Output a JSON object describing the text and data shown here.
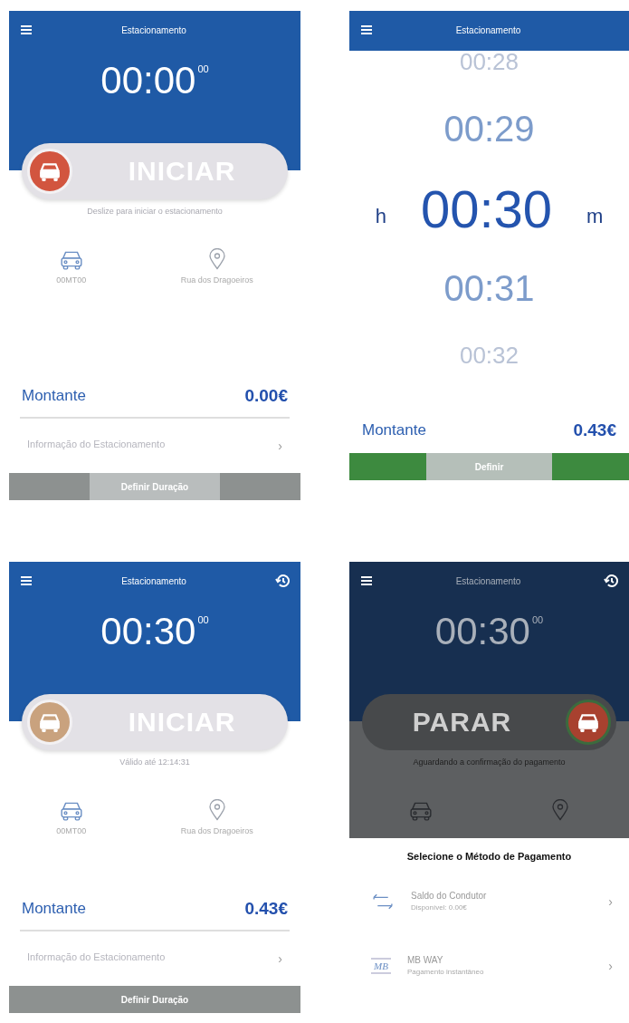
{
  "screens": [
    {
      "kind": "timer",
      "header": {
        "title": "Estacionamento",
        "history_icon": false
      },
      "timer": {
        "time": "00:00",
        "seconds": "00"
      },
      "slider": {
        "label": "INICIAR",
        "kind": "start",
        "color": "#d2553f"
      },
      "hint": "Deslize para iniciar o estacionamento",
      "info": [
        {
          "kind": "car",
          "label": "00MT00"
        },
        {
          "kind": "location",
          "label": "Rua dos Dragoeiros"
        }
      ],
      "amount": {
        "label": "Montante",
        "value": "0.00€"
      },
      "details_link": {
        "label": "Informação do Estacionamento",
        "chevron": "›"
      },
      "action_button": {
        "label": "Definir Duração",
        "kind": "split"
      }
    },
    {
      "kind": "picker",
      "header": {
        "title": "Estacionamento",
        "history_icon": false
      },
      "unit_left": "h",
      "unit_right": "m",
      "rows": [
        {
          "text": "00:28",
          "selected": false,
          "faded": true
        },
        {
          "text": "00:29",
          "selected": false,
          "faded": false
        },
        {
          "text": "00:30",
          "selected": true,
          "faded": false
        },
        {
          "text": "00:31",
          "selected": false,
          "faded": false
        },
        {
          "text": "00:32",
          "selected": false,
          "faded": true
        }
      ],
      "amount": {
        "label": "Montante",
        "value": "0.43€"
      },
      "action_button": {
        "label": "Definir",
        "kind": "accent"
      }
    },
    {
      "kind": "timer",
      "header": {
        "title": "Estacionamento",
        "history_icon": true
      },
      "timer": {
        "time": "00:30",
        "seconds": "00"
      },
      "slider": {
        "label": "INICIAR",
        "kind": "start",
        "color": "#c9a27e"
      },
      "hint": "Válido até 12:14:31",
      "info": [
        {
          "kind": "car",
          "label": "00MT00"
        },
        {
          "kind": "location",
          "label": "Rua dos Dragoeiros"
        }
      ],
      "amount": {
        "label": "Montante",
        "value": "0.43€"
      },
      "details_link": {
        "label": "Informação do Estacionamento",
        "chevron": "›"
      },
      "action_button": {
        "label": "Definir Duração",
        "kind": "solid"
      }
    },
    {
      "kind": "timer",
      "dimmed": true,
      "header": {
        "title": "Estacionamento",
        "history_icon": true
      },
      "timer": {
        "time": "00:30",
        "seconds": "00"
      },
      "slider": {
        "label": "PARAR",
        "kind": "end",
        "color": "#a8412f"
      },
      "hint": "Aguardando a confirmação do pagamento",
      "info": [
        {
          "kind": "car"
        },
        {
          "kind": "location"
        }
      ],
      "payment_sheet": {
        "title": "Selecione o Método de Pagamento",
        "methods": [
          {
            "kind": "balance",
            "name": "Saldo do Condutor",
            "detail": "Disponível: 0.00€",
            "chevron": "›"
          },
          {
            "kind": "mbway",
            "logo_text": "MB",
            "name": "MB WAY",
            "detail": "Pagamento instantâneo",
            "chevron": "›"
          }
        ]
      }
    }
  ]
}
